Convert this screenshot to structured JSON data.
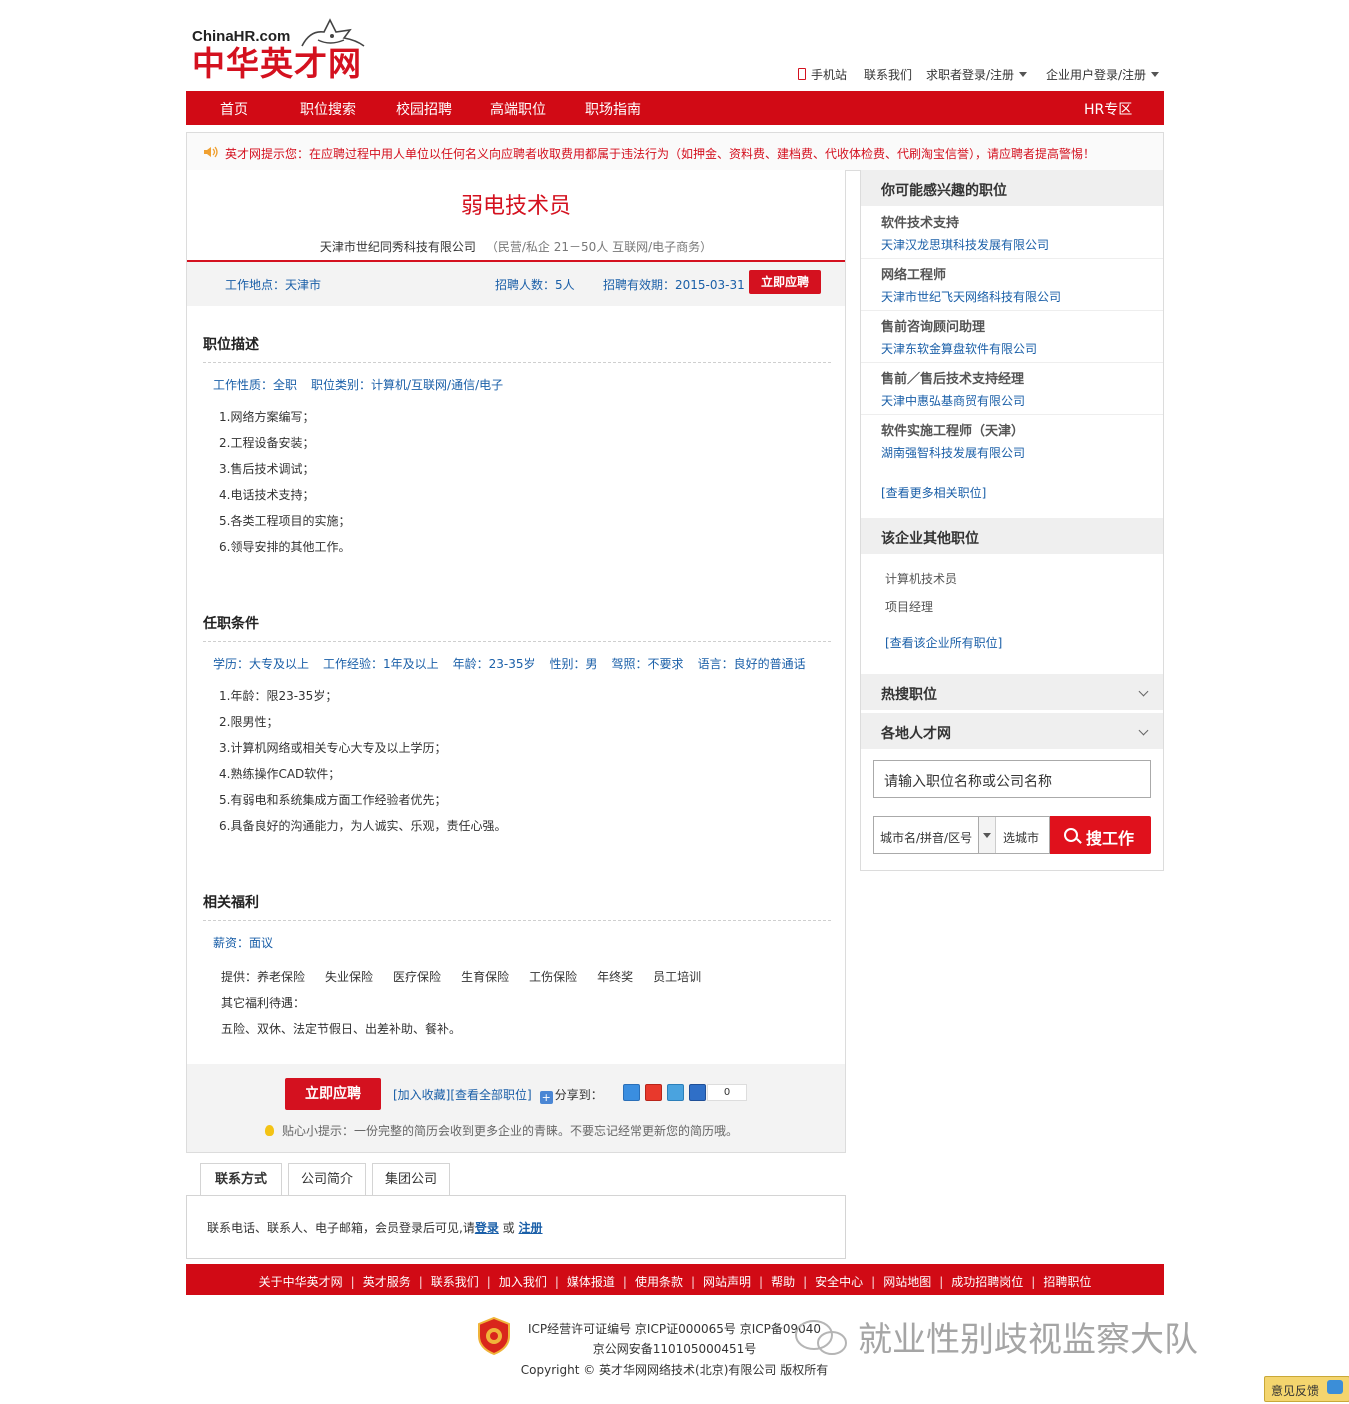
{
  "brand": {
    "logo_en": "ChinaHR.com",
    "logo_cn": "中华英才网",
    "red": "#d4111f",
    "nav_red": "#d10a15",
    "link_blue": "#1a5fa8"
  },
  "toplinks": {
    "mobile": "手机站",
    "contact": "联系我们",
    "seeker": "求职者登录/注册",
    "employer": "企业用户登录/注册"
  },
  "nav": {
    "items": [
      "首页",
      "职位搜索",
      "校园招聘",
      "高端职位",
      "职场指南"
    ],
    "hr": "HR专区"
  },
  "notice": "英才网提示您：在应聘过程中用人单位以任何名义向应聘者收取费用都属于违法行为（如押金、资料费、建档费、代收体检费、代刷淘宝信誉），请应聘者提高警惕！",
  "job": {
    "title": "弱电技术员",
    "company": "天津市世纪同秀科技有限公司",
    "company_ext": "（民营/私企 21－50人 互联网/电子商务）",
    "location": "工作地点：天津市",
    "headcount": "招聘人数：5人",
    "valid": "招聘有效期：2015-03-31",
    "apply": "立即应聘"
  },
  "desc": {
    "heading": "职位描述",
    "tags": [
      "工作性质：全职",
      "职位类别：计算机/互联网/通信/电子"
    ],
    "items": [
      "1.网络方案编写；",
      "2.工程设备安装；",
      "3.售后技术调试；",
      "4.电话技术支持；",
      "5.各类工程项目的实施；",
      "6.领导安排的其他工作。"
    ]
  },
  "req": {
    "heading": "任职条件",
    "tags": [
      "学历：大专及以上",
      "工作经验：1年及以上",
      "年龄：23-35岁",
      "性别：男",
      "驾照：不要求",
      "语言：良好的普通话"
    ],
    "items": [
      "1.年龄：限23-35岁；",
      "2.限男性；",
      "3.计算机网络或相关专心大专及以上学历；",
      "4.熟练操作CAD软件；",
      "5.有弱电和系统集成方面工作经验者优先；",
      "6.具备良好的沟通能力，为人诚实、乐观，责任心强。"
    ]
  },
  "welfare": {
    "heading": "相关福利",
    "salary": "薪资：面议",
    "provide_label": "提供：",
    "provide": [
      "养老保险",
      "失业保险",
      "医疗保险",
      "生育保险",
      "工伤保险",
      "年终奖",
      "员工培训"
    ],
    "other_label": "其它福利待遇：",
    "other": "五险、双休、法定节假日、出差补助、餐补。"
  },
  "bottom": {
    "apply": "立即应聘",
    "favorite": "[加入收藏]",
    "all_jobs": "[查看全部职位]",
    "share": "分享到：",
    "share_count": "0",
    "tip": "贴心小提示：一份完整的简历会收到更多企业的青睐。不要忘记经常更新您的简历哦。"
  },
  "tabs": [
    "联系方式",
    "公司简介",
    "集团公司"
  ],
  "contact": {
    "text": "联系电话、联系人、电子邮箱，会员登录后可见,请",
    "login": "登录",
    "or": "或",
    "register": "注册"
  },
  "sidebar": {
    "interest_heading": "你可能感兴趣的职位",
    "recs": [
      {
        "title": "软件技术支持",
        "company": "天津汉龙思琪科技发展有限公司"
      },
      {
        "title": "网络工程师",
        "company": "天津市世纪飞天网络科技有限公司"
      },
      {
        "title": "售前咨询顾问助理",
        "company": "天津东软金算盘软件有限公司"
      },
      {
        "title": "售前／售后技术支持经理",
        "company": "天津中惠弘基商贸有限公司"
      },
      {
        "title": "软件实施工程师（天津）",
        "company": "湖南强智科技发展有限公司"
      }
    ],
    "more_related": "[查看更多相关职位]",
    "other_heading": "该企业其他职位",
    "other_jobs": [
      "计算机技术员",
      "项目经理"
    ],
    "all_company_jobs": "[查看该企业所有职位]",
    "hot_heading": "热搜职位",
    "local_heading": "各地人才网",
    "search_placeholder": "请输入职位名称或公司名称",
    "city_placeholder": "城市名/拼音/区号",
    "city_select": "选城市",
    "search_button": "搜工作"
  },
  "footer": {
    "links": [
      "关于中华英才网",
      "英才服务",
      "联系我们",
      "加入我们",
      "媒体报道",
      "使用条款",
      "网站声明",
      "帮助",
      "安全中心",
      "网站地图",
      "成功招聘岗位",
      "招聘职位"
    ],
    "icp1": "ICP经营许可证编号 京ICP证000065号 京ICP备09040",
    "icp2": "京公网安备110105000451号",
    "copyright": "Copyright © 英才华网网络技术(北京)有限公司 版权所有"
  },
  "watermark": "就业性别歧视监察大队",
  "feedback": "意见反馈"
}
